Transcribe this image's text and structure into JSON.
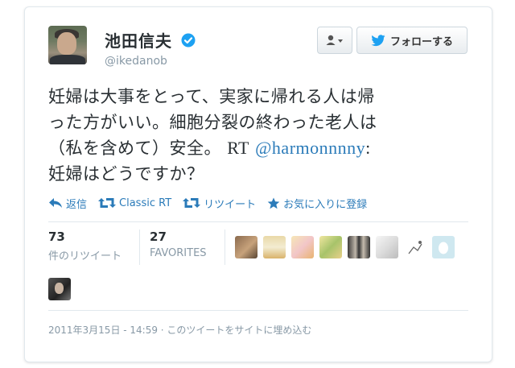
{
  "user": {
    "display_name": "池田信夫",
    "screen_name": "@ikedanob"
  },
  "buttons": {
    "follow_label": "フォローする"
  },
  "tweet": {
    "line1": "妊婦は大事をとって、実家に帰れる人は帰",
    "line2": "った方がいい。細胞分裂の終わった老人は",
    "line3_text": "（私を含めて）安全。",
    "line3_rt": "RT",
    "line3_mention": "@harmonnnny",
    "line3_colon": ":",
    "line4": "妊婦はどうですか？"
  },
  "actions": {
    "reply": "返信",
    "classic_rt": "Classic RT",
    "retweet": "リツイート",
    "favorite": "お気に入りに登録"
  },
  "stats": {
    "retweets_count": "73",
    "retweets_label": "件のリツイート",
    "favorites_count": "27",
    "favorites_label": "FAVORITES"
  },
  "meta": {
    "timestamp": "2011年3月15日 - 14:59 · このツイートをサイトに埋め込む"
  },
  "colors": {
    "link": "#2b7bb9",
    "verified": "#1da1f2",
    "muted": "#8899a6"
  }
}
